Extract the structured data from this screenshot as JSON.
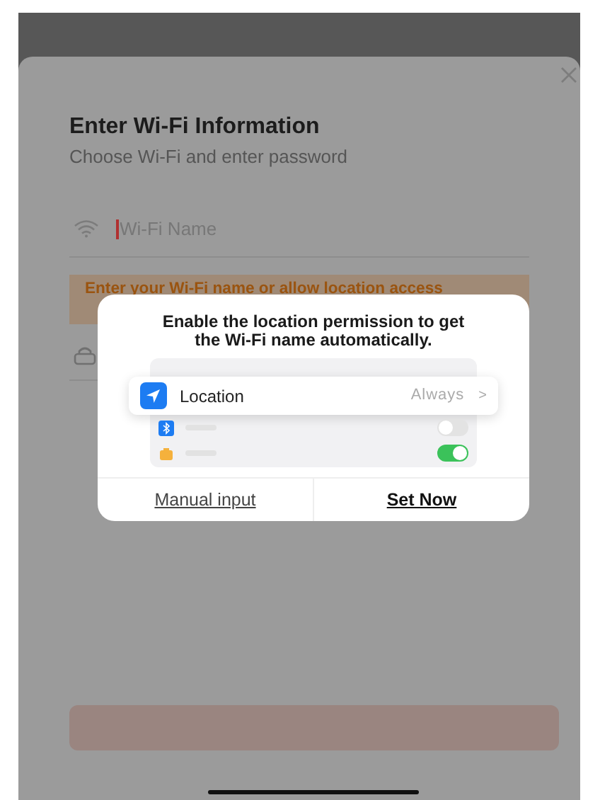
{
  "form": {
    "title": "Enter Wi-Fi Information",
    "subtitle": "Choose Wi-Fi and enter password",
    "wifi_field": {
      "placeholder": "Wi-Fi Name"
    },
    "warning": [
      "Enter your Wi-Fi name or allow location access"
    ]
  },
  "dialog": {
    "message": "Enable the location permission to get the Wi-Fi name automatically.",
    "location_row": {
      "label": "Location",
      "value": "Always",
      "chevron": ">"
    },
    "setting_rows": [
      {
        "kind": "bluetooth",
        "on": false
      },
      {
        "kind": "camera",
        "on": true
      }
    ],
    "buttons": [
      {
        "label": "Manual input",
        "kind": "secondary"
      },
      {
        "label": "Set Now",
        "kind": "primary"
      }
    ]
  }
}
